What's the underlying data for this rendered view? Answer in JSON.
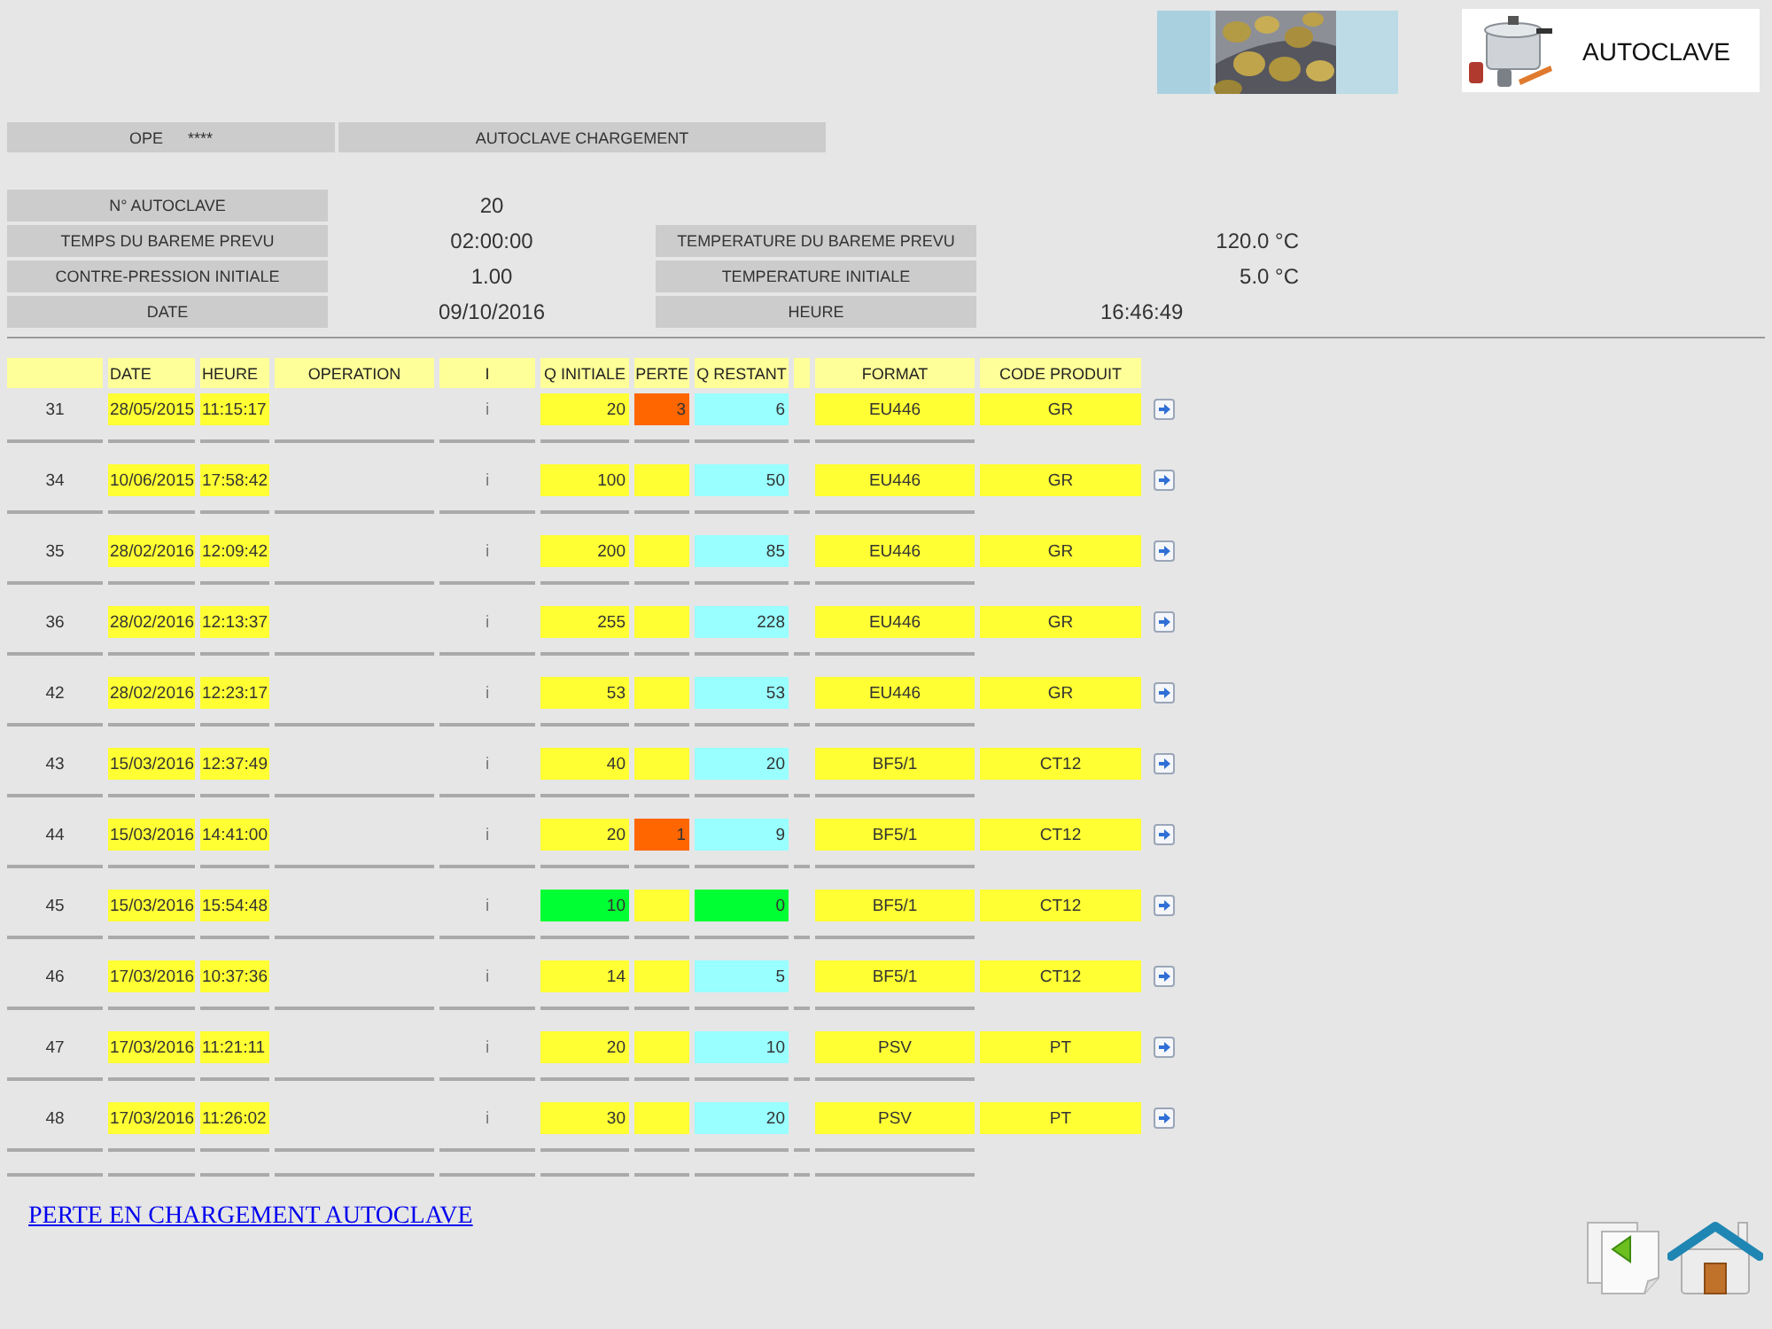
{
  "banner": {
    "title": "AUTOCLAVE"
  },
  "operator_bar": {
    "label": "OPE",
    "value": "****",
    "title": "AUTOCLAVE CHARGEMENT"
  },
  "details": [
    {
      "left": {
        "label": "N° AUTOCLAVE",
        "value": "20"
      }
    },
    {
      "left": {
        "label": "TEMPS DU BAREME PREVU",
        "value": "02:00:00"
      },
      "right": {
        "label": "TEMPERATURE DU BAREME PREVU",
        "value": "120.0 °C"
      }
    },
    {
      "left": {
        "label": "CONTRE-PRESSION INITIALE",
        "value": "1.00"
      },
      "right": {
        "label": "TEMPERATURE INITIALE",
        "value": "5.0 °C"
      }
    },
    {
      "left": {
        "label": "DATE",
        "value": "09/10/2016"
      },
      "right": {
        "label": "HEURE",
        "value": "16:46:49",
        "kind": "time"
      }
    }
  ],
  "table": {
    "columns": [
      {
        "kind": "blank"
      },
      {
        "kind": "label",
        "label": "DATE"
      },
      {
        "kind": "label",
        "label": "HEURE"
      },
      {
        "kind": "label",
        "label": "OPERATION"
      },
      {
        "kind": "label",
        "label": "I"
      },
      {
        "kind": "label",
        "label": "Q INITIALE"
      },
      {
        "kind": "label",
        "label": "PERTE"
      },
      {
        "kind": "label",
        "label": "Q RESTANT"
      },
      {
        "kind": "blank"
      },
      {
        "kind": "label",
        "label": "FORMAT"
      },
      {
        "kind": "label",
        "label": "CODE PRODUIT"
      }
    ],
    "rows": [
      {
        "number": "31",
        "date": "28/05/2015",
        "time": "11:15:17",
        "info": "i",
        "q_initiale": {
          "text": "20",
          "color": "#ffff33"
        },
        "perte": {
          "text": "3",
          "color": "#ff6600"
        },
        "q_restant": {
          "text": "6",
          "color": "#99ffff"
        },
        "format": "EU446",
        "code_produit": "GR"
      },
      {
        "number": "34",
        "date": "10/06/2015",
        "time": "17:58:42",
        "info": "i",
        "q_initiale": {
          "text": "100",
          "color": "#ffff33"
        },
        "perte": {
          "color": "#ffff33"
        },
        "q_restant": {
          "text": "50",
          "color": "#99ffff"
        },
        "format": "EU446",
        "code_produit": "GR"
      },
      {
        "number": "35",
        "date": "28/02/2016",
        "time": "12:09:42",
        "info": "i",
        "q_initiale": {
          "text": "200",
          "color": "#ffff33"
        },
        "perte": {
          "color": "#ffff33"
        },
        "q_restant": {
          "text": "85",
          "color": "#99ffff"
        },
        "format": "EU446",
        "code_produit": "GR"
      },
      {
        "number": "36",
        "date": "28/02/2016",
        "time": "12:13:37",
        "info": "i",
        "q_initiale": {
          "text": "255",
          "color": "#ffff33"
        },
        "perte": {
          "color": "#ffff33"
        },
        "q_restant": {
          "text": "228",
          "color": "#99ffff"
        },
        "format": "EU446",
        "code_produit": "GR"
      },
      {
        "number": "42",
        "date": "28/02/2016",
        "time": "12:23:17",
        "info": "i",
        "q_initiale": {
          "text": "53",
          "color": "#ffff33"
        },
        "perte": {
          "color": "#ffff33"
        },
        "q_restant": {
          "text": "53",
          "color": "#99ffff"
        },
        "format": "EU446",
        "code_produit": "GR"
      },
      {
        "number": "43",
        "date": "15/03/2016",
        "time": "12:37:49",
        "info": "i",
        "q_initiale": {
          "text": "40",
          "color": "#ffff33"
        },
        "perte": {
          "color": "#ffff33"
        },
        "q_restant": {
          "text": "20",
          "color": "#99ffff"
        },
        "format": "BF5/1",
        "code_produit": "CT12"
      },
      {
        "number": "44",
        "date": "15/03/2016",
        "time": "14:41:00",
        "info": "i",
        "q_initiale": {
          "text": "20",
          "color": "#ffff33"
        },
        "perte": {
          "text": "1",
          "color": "#ff6600"
        },
        "q_restant": {
          "text": "9",
          "color": "#99ffff"
        },
        "format": "BF5/1",
        "code_produit": "CT12"
      },
      {
        "number": "45",
        "date": "15/03/2016",
        "time": "15:54:48",
        "info": "i",
        "q_initiale": {
          "text": "10",
          "color": "#00ff33"
        },
        "perte": {
          "color": "#ffff33"
        },
        "q_restant": {
          "text": "0",
          "color": "#00ff33"
        },
        "format": "BF5/1",
        "code_produit": "CT12"
      },
      {
        "number": "46",
        "date": "17/03/2016",
        "time": "10:37:36",
        "info": "i",
        "q_initiale": {
          "text": "14",
          "color": "#ffff33"
        },
        "perte": {
          "color": "#ffff33"
        },
        "q_restant": {
          "text": "5",
          "color": "#99ffff"
        },
        "format": "BF5/1",
        "code_produit": "CT12"
      },
      {
        "number": "47",
        "date": "17/03/2016",
        "time": "11:21:11",
        "info": "i",
        "q_initiale": {
          "text": "20",
          "color": "#ffff33"
        },
        "perte": {
          "color": "#ffff33"
        },
        "q_restant": {
          "text": "10",
          "color": "#99ffff"
        },
        "format": "PSV",
        "code_produit": "PT"
      },
      {
        "number": "48",
        "date": "17/03/2016",
        "time": "11:26:02",
        "info": "i",
        "q_initiale": {
          "text": "30",
          "color": "#ffff33"
        },
        "perte": {
          "color": "#ffff33"
        },
        "q_restant": {
          "text": "20",
          "color": "#99ffff"
        },
        "format": "PSV",
        "code_produit": "PT"
      }
    ]
  },
  "footer": {
    "link": "PERTE EN CHARGEMENT AUTOCLAVE"
  }
}
